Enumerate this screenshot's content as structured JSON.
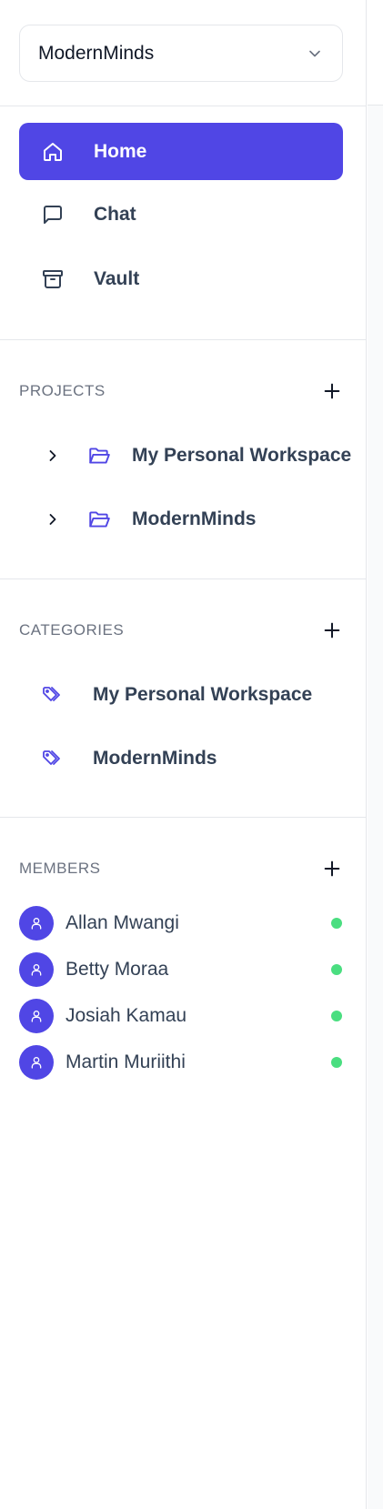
{
  "workspace": {
    "selected": "ModernMinds",
    "chevron_icon": "chevron-down-icon"
  },
  "nav": {
    "items": [
      {
        "label": "Home",
        "icon": "home-icon",
        "active": true
      },
      {
        "label": "Chat",
        "icon": "message-icon",
        "active": false
      },
      {
        "label": "Vault",
        "icon": "archive-icon",
        "active": false
      }
    ]
  },
  "projects": {
    "title": "PROJECTS",
    "items": [
      {
        "label": "My Personal Workspace"
      },
      {
        "label": "ModernMinds"
      }
    ]
  },
  "categories": {
    "title": "CATEGORIES",
    "items": [
      {
        "label": "My Personal Workspace"
      },
      {
        "label": "ModernMinds"
      }
    ]
  },
  "members": {
    "title": "MEMBERS",
    "items": [
      {
        "name": "Allan Mwangi",
        "status": "online"
      },
      {
        "name": "Betty Moraa",
        "status": "online"
      },
      {
        "name": "Josiah Kamau",
        "status": "online"
      },
      {
        "name": "Martin Muriithi",
        "status": "online"
      }
    ]
  },
  "colors": {
    "accent": "#5046e5",
    "online": "#4ade80",
    "text": "#334155",
    "muted": "#6b7280",
    "border": "#e5e7eb"
  }
}
